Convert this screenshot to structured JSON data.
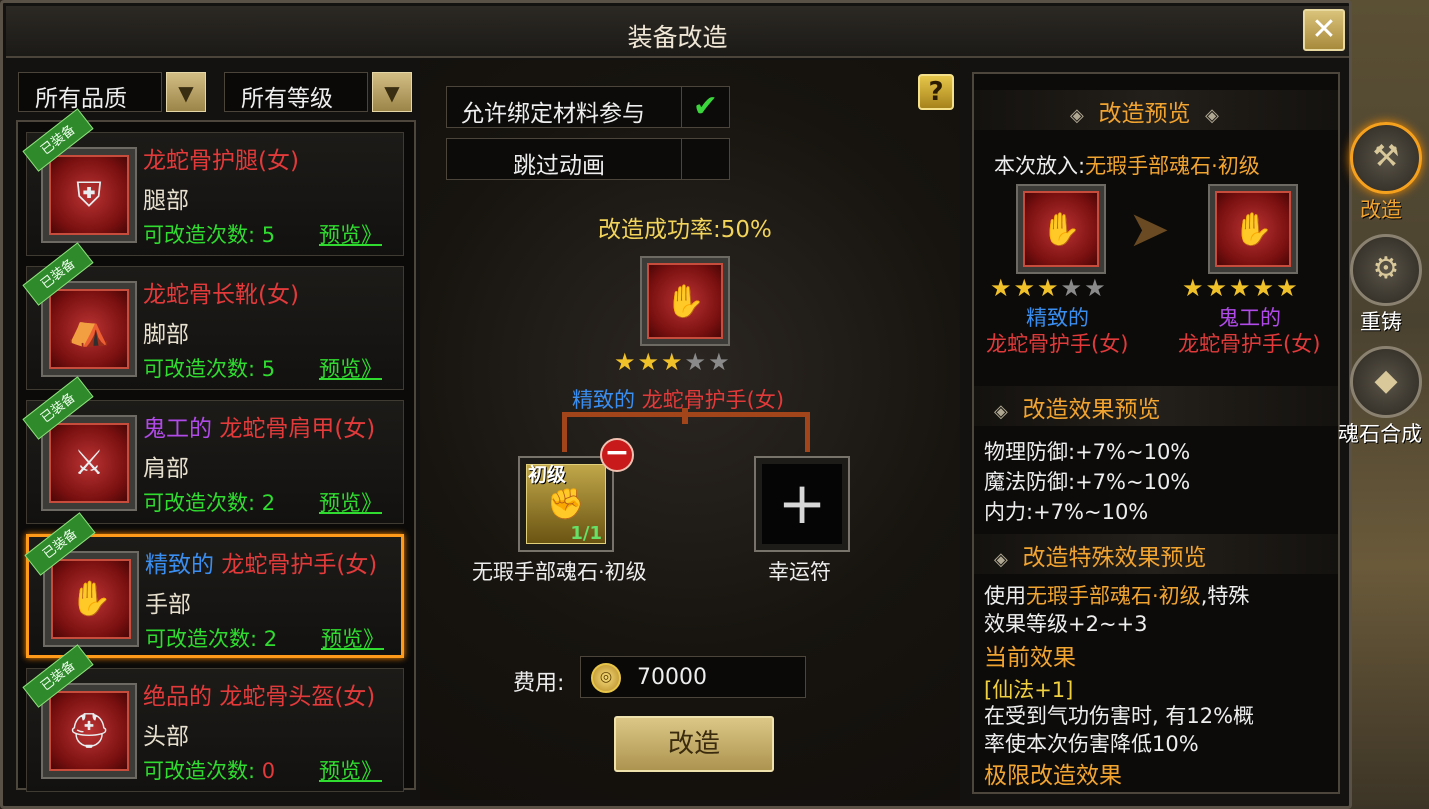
{
  "window": {
    "title": "装备改造",
    "close_label": "✕"
  },
  "filters": {
    "quality": "所有品质",
    "level": "所有等级",
    "dropdown_glyph": "▼"
  },
  "items": [
    {
      "prefix": "",
      "name": "龙蛇骨护腿(女)",
      "name_color": "red",
      "part": "腿部",
      "count_label": "可改造次数:",
      "count": "5",
      "count_color": "green",
      "preview": "预览》",
      "equipped": "已装备",
      "icon": "leg-armor-icon",
      "glyph": "⛨"
    },
    {
      "prefix": "",
      "name": "龙蛇骨长靴(女)",
      "name_color": "red",
      "part": "脚部",
      "count_label": "可改造次数:",
      "count": "5",
      "count_color": "green",
      "preview": "预览》",
      "equipped": "已装备",
      "icon": "boots-icon",
      "glyph": "⛺"
    },
    {
      "prefix": "鬼工的",
      "prefix_color": "purple",
      "name": "龙蛇骨肩甲(女)",
      "name_color": "red",
      "part": "肩部",
      "count_label": "可改造次数:",
      "count": "2",
      "count_color": "green",
      "preview": "预览》",
      "equipped": "已装备",
      "icon": "shoulder-armor-icon",
      "glyph": "⚔"
    },
    {
      "prefix": "精致的",
      "prefix_color": "blue",
      "name": "龙蛇骨护手(女)",
      "name_color": "red",
      "part": "手部",
      "count_label": "可改造次数:",
      "count": "2",
      "count_color": "green",
      "preview": "预览》",
      "equipped": "已装备",
      "icon": "gauntlet-icon",
      "glyph": "✋",
      "selected": true
    },
    {
      "prefix": "绝品的",
      "prefix_color": "red",
      "name": "龙蛇骨头盔(女)",
      "name_color": "red",
      "part": "头部",
      "count_label": "可改造次数:",
      "count": "0",
      "count_color": "red",
      "preview": "预览》",
      "equipped": "已装备",
      "icon": "helmet-icon",
      "glyph": "⛑"
    }
  ],
  "center": {
    "allow_bound": "允许绑定材料参与",
    "allow_bound_checked": "✔",
    "skip_anim": "跳过动画",
    "help": "?",
    "success_rate": "改造成功率:50%",
    "target": {
      "prefix": "精致的",
      "name": "龙蛇骨护手(女)",
      "stars": 3,
      "max_stars": 5
    },
    "material": {
      "tag": "初级",
      "count": "1/1",
      "label": "无瑕手部魂石·初级"
    },
    "lucky": {
      "plus": "+",
      "label": "幸运符"
    },
    "remove": "−",
    "cost_label": "费用:",
    "cost": "70000",
    "coin": "◎",
    "go": "改造"
  },
  "preview": {
    "header": "改造预览",
    "dia": "◈",
    "placed_label": "本次放入:",
    "placed_value": "无瑕手部魂石·初级",
    "before": {
      "prefix": "精致的",
      "name": "龙蛇骨护手(女)",
      "stars": 3
    },
    "after": {
      "prefix": "鬼工的",
      "name": "龙蛇骨护手(女)",
      "stars": 5
    },
    "arrow": "➤",
    "effect_header": "改造效果预览",
    "effects": [
      "物理防御:+7%~10%",
      "魔法防御:+7%~10%",
      "内力:+7%~10%"
    ],
    "special_header": "改造特殊效果预览",
    "special_line1a": "使用",
    "special_line1b": "无瑕手部魂石·初级",
    "special_line1c": ",特殊",
    "special_line2": "效果等级+2~+3",
    "current_effect": "当前效果",
    "xianfa": "[仙法+1]",
    "desc1": "在受到气功伤害时, 有12%概",
    "desc2": "率使本次伤害降低10%",
    "limit": "极限改造效果"
  },
  "side": [
    {
      "label": "改造",
      "glyph": "⚒",
      "active": true
    },
    {
      "label": "重铸",
      "glyph": "⚙"
    },
    {
      "label": "魂石合成",
      "glyph": "◆"
    }
  ],
  "colors": {
    "accent": "#f2a431",
    "green": "#2fdc2f",
    "red": "#e23a3a",
    "blue": "#3a8ef0",
    "purple": "#b04ae8",
    "gold": "#f1c12a"
  }
}
